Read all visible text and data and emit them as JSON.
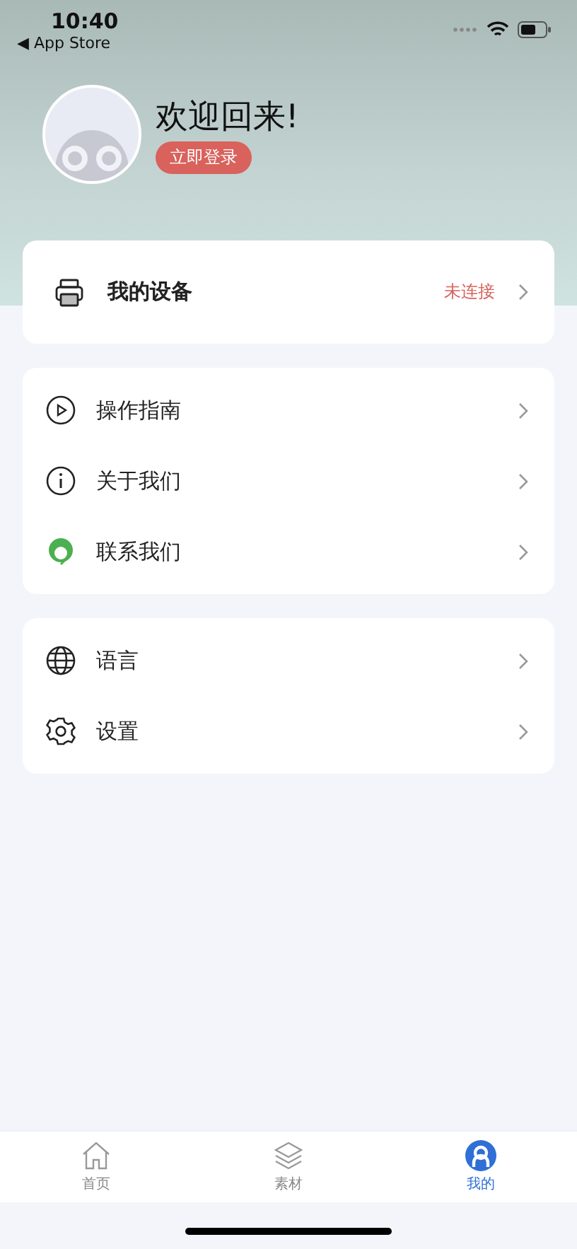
{
  "status_bar": {
    "time": "10:40",
    "back_link": "◀ App Store"
  },
  "profile": {
    "greeting": "欢迎回来!",
    "login_button": "立即登录"
  },
  "device": {
    "label": "我的设备",
    "status": "未连接",
    "connected": false
  },
  "sections": [
    {
      "items": [
        {
          "label": "操作指南"
        },
        {
          "label": "关于我们"
        },
        {
          "label": "联系我们"
        }
      ]
    },
    {
      "items": [
        {
          "label": "语言"
        },
        {
          "label": "设置"
        }
      ]
    }
  ],
  "tab_bar": [
    {
      "label": "首页",
      "selected": false
    },
    {
      "label": "素材",
      "selected": false
    },
    {
      "label": "我的",
      "selected": true
    }
  ]
}
